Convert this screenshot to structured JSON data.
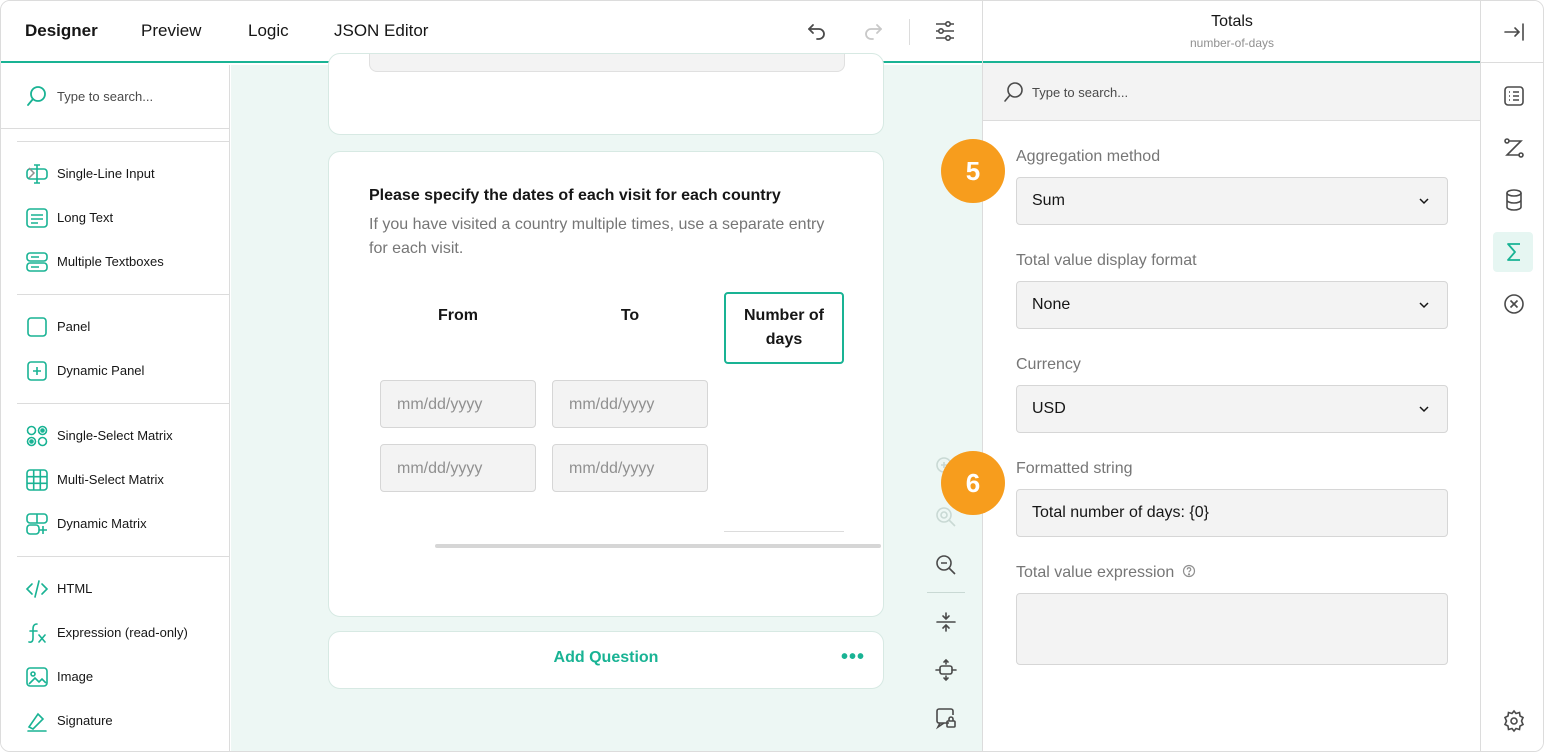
{
  "tabs": [
    "Designer",
    "Preview",
    "Logic",
    "JSON Editor"
  ],
  "toolbox": {
    "search_placeholder": "Type to search...",
    "items": [
      {
        "label": "Single-Line Input",
        "icon": "text-cursor-icon",
        "has_submenu": true
      },
      {
        "label": "Long Text",
        "icon": "long-text-icon"
      },
      {
        "label": "Multiple Textboxes",
        "icon": "multiple-textboxes-icon"
      },
      {
        "label": "Panel",
        "icon": "panel-icon"
      },
      {
        "label": "Dynamic Panel",
        "icon": "dynamic-panel-icon"
      },
      {
        "label": "Single-Select Matrix",
        "icon": "single-matrix-icon"
      },
      {
        "label": "Multi-Select Matrix",
        "icon": "multi-matrix-icon"
      },
      {
        "label": "Dynamic Matrix",
        "icon": "dynamic-matrix-icon"
      },
      {
        "label": "HTML",
        "icon": "html-icon"
      },
      {
        "label": "Expression (read-only)",
        "icon": "expression-icon"
      },
      {
        "label": "Image",
        "icon": "image-icon"
      },
      {
        "label": "Signature",
        "icon": "signature-icon"
      }
    ]
  },
  "question": {
    "title": "Please specify the dates of each visit for each country",
    "description": "If you have visited a country multiple times, use a separate entry for each visit.",
    "columns": [
      "From",
      "To",
      "Number of days"
    ],
    "date_placeholder": "mm/dd/yyyy"
  },
  "add_question_label": "Add Question",
  "more_label": "•••",
  "property_grid": {
    "title": "Totals",
    "subtitle": "number-of-days",
    "search_placeholder": "Type to search...",
    "aggregation_label": "Aggregation method",
    "aggregation_value": "Sum",
    "display_format_label": "Total value display format",
    "display_format_value": "None",
    "currency_label": "Currency",
    "currency_value": "USD",
    "formatted_string_label": "Formatted string",
    "formatted_string_value": "Total number of days: {0}",
    "expression_label": "Total value expression"
  },
  "badges": [
    "5",
    "6"
  ],
  "colors": {
    "accent": "#19b394",
    "badge": "#f79d1d",
    "canvas_bg": "#edf7f4"
  }
}
